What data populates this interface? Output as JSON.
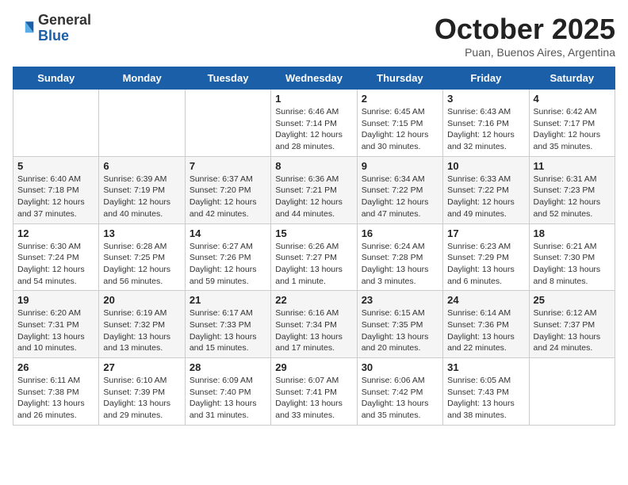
{
  "logo": {
    "general": "General",
    "blue": "Blue"
  },
  "title": "October 2025",
  "subtitle": "Puan, Buenos Aires, Argentina",
  "days_of_week": [
    "Sunday",
    "Monday",
    "Tuesday",
    "Wednesday",
    "Thursday",
    "Friday",
    "Saturday"
  ],
  "weeks": [
    [
      {
        "day": "",
        "info": ""
      },
      {
        "day": "",
        "info": ""
      },
      {
        "day": "",
        "info": ""
      },
      {
        "day": "1",
        "info": "Sunrise: 6:46 AM\nSunset: 7:14 PM\nDaylight: 12 hours\nand 28 minutes."
      },
      {
        "day": "2",
        "info": "Sunrise: 6:45 AM\nSunset: 7:15 PM\nDaylight: 12 hours\nand 30 minutes."
      },
      {
        "day": "3",
        "info": "Sunrise: 6:43 AM\nSunset: 7:16 PM\nDaylight: 12 hours\nand 32 minutes."
      },
      {
        "day": "4",
        "info": "Sunrise: 6:42 AM\nSunset: 7:17 PM\nDaylight: 12 hours\nand 35 minutes."
      }
    ],
    [
      {
        "day": "5",
        "info": "Sunrise: 6:40 AM\nSunset: 7:18 PM\nDaylight: 12 hours\nand 37 minutes."
      },
      {
        "day": "6",
        "info": "Sunrise: 6:39 AM\nSunset: 7:19 PM\nDaylight: 12 hours\nand 40 minutes."
      },
      {
        "day": "7",
        "info": "Sunrise: 6:37 AM\nSunset: 7:20 PM\nDaylight: 12 hours\nand 42 minutes."
      },
      {
        "day": "8",
        "info": "Sunrise: 6:36 AM\nSunset: 7:21 PM\nDaylight: 12 hours\nand 44 minutes."
      },
      {
        "day": "9",
        "info": "Sunrise: 6:34 AM\nSunset: 7:22 PM\nDaylight: 12 hours\nand 47 minutes."
      },
      {
        "day": "10",
        "info": "Sunrise: 6:33 AM\nSunset: 7:22 PM\nDaylight: 12 hours\nand 49 minutes."
      },
      {
        "day": "11",
        "info": "Sunrise: 6:31 AM\nSunset: 7:23 PM\nDaylight: 12 hours\nand 52 minutes."
      }
    ],
    [
      {
        "day": "12",
        "info": "Sunrise: 6:30 AM\nSunset: 7:24 PM\nDaylight: 12 hours\nand 54 minutes."
      },
      {
        "day": "13",
        "info": "Sunrise: 6:28 AM\nSunset: 7:25 PM\nDaylight: 12 hours\nand 56 minutes."
      },
      {
        "day": "14",
        "info": "Sunrise: 6:27 AM\nSunset: 7:26 PM\nDaylight: 12 hours\nand 59 minutes."
      },
      {
        "day": "15",
        "info": "Sunrise: 6:26 AM\nSunset: 7:27 PM\nDaylight: 13 hours\nand 1 minute."
      },
      {
        "day": "16",
        "info": "Sunrise: 6:24 AM\nSunset: 7:28 PM\nDaylight: 13 hours\nand 3 minutes."
      },
      {
        "day": "17",
        "info": "Sunrise: 6:23 AM\nSunset: 7:29 PM\nDaylight: 13 hours\nand 6 minutes."
      },
      {
        "day": "18",
        "info": "Sunrise: 6:21 AM\nSunset: 7:30 PM\nDaylight: 13 hours\nand 8 minutes."
      }
    ],
    [
      {
        "day": "19",
        "info": "Sunrise: 6:20 AM\nSunset: 7:31 PM\nDaylight: 13 hours\nand 10 minutes."
      },
      {
        "day": "20",
        "info": "Sunrise: 6:19 AM\nSunset: 7:32 PM\nDaylight: 13 hours\nand 13 minutes."
      },
      {
        "day": "21",
        "info": "Sunrise: 6:17 AM\nSunset: 7:33 PM\nDaylight: 13 hours\nand 15 minutes."
      },
      {
        "day": "22",
        "info": "Sunrise: 6:16 AM\nSunset: 7:34 PM\nDaylight: 13 hours\nand 17 minutes."
      },
      {
        "day": "23",
        "info": "Sunrise: 6:15 AM\nSunset: 7:35 PM\nDaylight: 13 hours\nand 20 minutes."
      },
      {
        "day": "24",
        "info": "Sunrise: 6:14 AM\nSunset: 7:36 PM\nDaylight: 13 hours\nand 22 minutes."
      },
      {
        "day": "25",
        "info": "Sunrise: 6:12 AM\nSunset: 7:37 PM\nDaylight: 13 hours\nand 24 minutes."
      }
    ],
    [
      {
        "day": "26",
        "info": "Sunrise: 6:11 AM\nSunset: 7:38 PM\nDaylight: 13 hours\nand 26 minutes."
      },
      {
        "day": "27",
        "info": "Sunrise: 6:10 AM\nSunset: 7:39 PM\nDaylight: 13 hours\nand 29 minutes."
      },
      {
        "day": "28",
        "info": "Sunrise: 6:09 AM\nSunset: 7:40 PM\nDaylight: 13 hours\nand 31 minutes."
      },
      {
        "day": "29",
        "info": "Sunrise: 6:07 AM\nSunset: 7:41 PM\nDaylight: 13 hours\nand 33 minutes."
      },
      {
        "day": "30",
        "info": "Sunrise: 6:06 AM\nSunset: 7:42 PM\nDaylight: 13 hours\nand 35 minutes."
      },
      {
        "day": "31",
        "info": "Sunrise: 6:05 AM\nSunset: 7:43 PM\nDaylight: 13 hours\nand 38 minutes."
      },
      {
        "day": "",
        "info": ""
      }
    ]
  ]
}
